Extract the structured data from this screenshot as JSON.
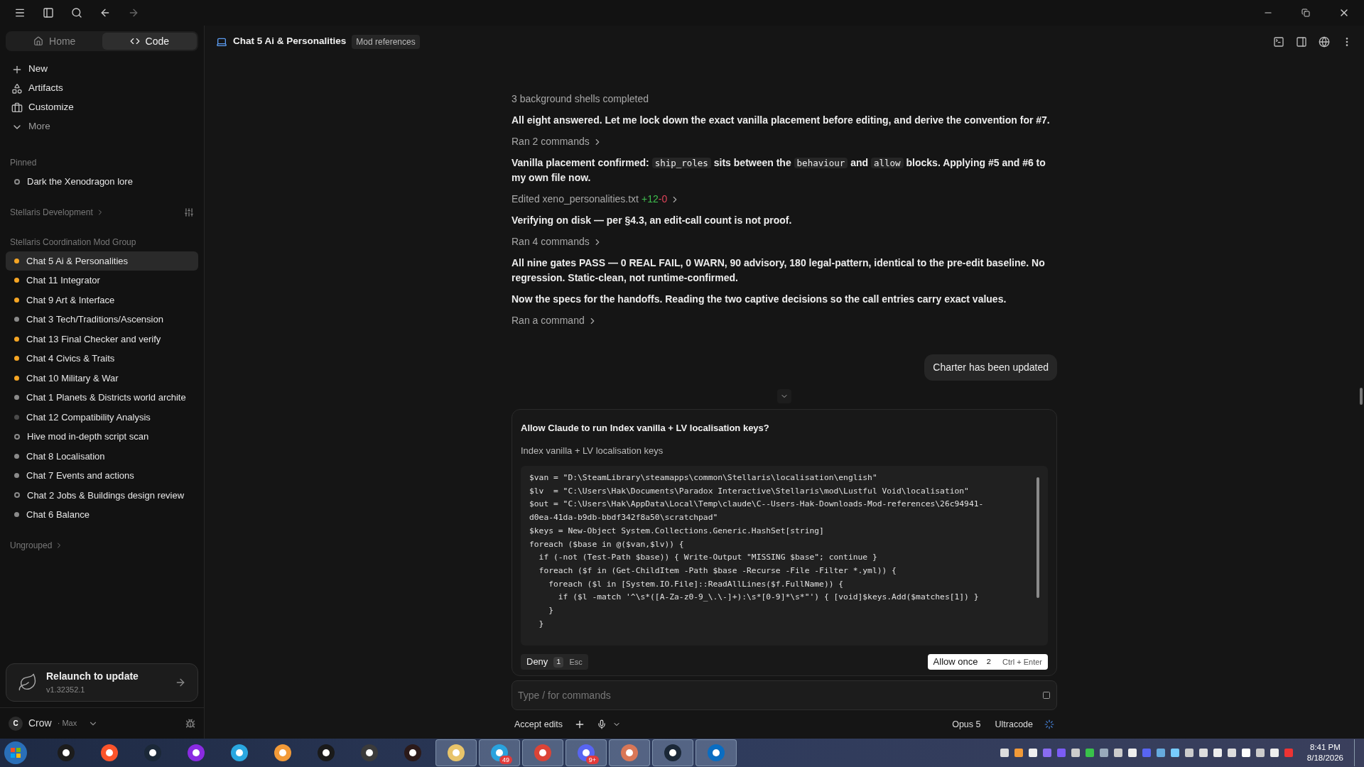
{
  "sidebar": {
    "tabs": [
      {
        "label": "Home",
        "selected": false
      },
      {
        "label": "Code",
        "selected": true
      }
    ],
    "nav": [
      {
        "label": "New",
        "kind": "new"
      },
      {
        "label": "Artifacts",
        "kind": "artifacts"
      },
      {
        "label": "Customize",
        "kind": "customize"
      },
      {
        "label": "More",
        "kind": "more"
      }
    ],
    "pinned": {
      "title": "Pinned",
      "items": [
        {
          "label": "Dark the Xenodragon lore",
          "color": "#8a8a8a",
          "kind": "hollow",
          "selected": false
        }
      ]
    },
    "groups": [
      {
        "title": "Stellaris Development"
      },
      {
        "title": "Stellaris Coordination Mod Group",
        "items": [
          {
            "label": "Chat 5 Ai & Personalities",
            "color": "#f5a524",
            "kind": "filled",
            "selected": true
          },
          {
            "label": "Chat 11 Integrator",
            "color": "#f5a524",
            "kind": "filled",
            "selected": false
          },
          {
            "label": "Chat 9 Art & Interface",
            "color": "#f5a524",
            "kind": "filled",
            "selected": false
          },
          {
            "label": "Chat 3 Tech/Traditions/Ascension",
            "color": "#8a8a8a",
            "kind": "filled",
            "selected": false
          },
          {
            "label": "Chat 13 Final Checker and verify",
            "color": "#f5a524",
            "kind": "filled",
            "selected": false
          },
          {
            "label": "Chat 4 Civics & Traits",
            "color": "#f5a524",
            "kind": "filled",
            "selected": false
          },
          {
            "label": "Chat 10 Military & War",
            "color": "#f5a524",
            "kind": "filled",
            "selected": false
          },
          {
            "label": "Chat 1 Planets & Districts world archite",
            "color": "#8a8a8a",
            "kind": "filled",
            "selected": false
          },
          {
            "label": "Chat 12 Compatibility Analysis",
            "color": "#4a4a4a",
            "kind": "filled",
            "selected": false
          },
          {
            "label": "Hive mod in-depth script scan",
            "color": "#8a8a8a",
            "kind": "hollow",
            "selected": false
          },
          {
            "label": "Chat 8 Localisation",
            "color": "#8a8a8a",
            "kind": "filled",
            "selected": false
          },
          {
            "label": "Chat 7 Events and actions",
            "color": "#8a8a8a",
            "kind": "filled",
            "selected": false
          },
          {
            "label": "Chat 2 Jobs & Buildings design review",
            "color": "#8a8a8a",
            "kind": "hollow",
            "selected": false
          },
          {
            "label": "Chat 6 Balance",
            "color": "#8a8a8a",
            "kind": "filled",
            "selected": false
          }
        ]
      },
      {
        "title": "Ungrouped"
      }
    ],
    "update": {
      "title": "Relaunch to update",
      "version": "v1.32352.1"
    },
    "user": {
      "initial": "C",
      "name": "Crow",
      "plan": "· Max"
    }
  },
  "header": {
    "title": "Chat 5 Ai & Personalities",
    "tag": "Mod references"
  },
  "messages": [
    {
      "kind": "status",
      "text": "3 background shells completed"
    },
    {
      "kind": "text",
      "parts": [
        {
          "kind": "text",
          "text": "All eight answered. Let me lock down the exact vanilla placement before editing, and derive the convention for #7."
        }
      ]
    },
    {
      "kind": "action",
      "text": "Ran 2 commands"
    },
    {
      "kind": "text",
      "parts": [
        {
          "kind": "text",
          "text": "Vanilla placement confirmed: "
        },
        {
          "kind": "code",
          "text": "ship_roles"
        },
        {
          "kind": "text",
          "text": " sits between the "
        },
        {
          "kind": "code",
          "text": "behaviour"
        },
        {
          "kind": "text",
          "text": " and "
        },
        {
          "kind": "code",
          "text": "allow"
        },
        {
          "kind": "text",
          "text": " blocks. Applying #5 and #6 to my own file now."
        }
      ]
    },
    {
      "kind": "edit",
      "text": "Edited xeno_personalities.txt",
      "added": "+12",
      "removed": "-0"
    },
    {
      "kind": "text",
      "parts": [
        {
          "kind": "text",
          "text": "Verifying on disk — per §4.3, an edit-call count is not proof."
        }
      ]
    },
    {
      "kind": "action",
      "text": "Ran 4 commands"
    },
    {
      "kind": "text",
      "parts": [
        {
          "kind": "text",
          "text": "All nine gates PASS — **0 REAL FAIL, 0 WARN, 90 advisory, 180 legal-pattern**, identical to the pre-edit baseline. No regression. Static-clean, not runtime-confirmed."
        }
      ]
    },
    {
      "kind": "text",
      "parts": [
        {
          "kind": "text",
          "text": "Now the specs for the handoffs. Reading the two captive decisions so the call entries carry exact values."
        }
      ]
    },
    {
      "kind": "action",
      "text": "Ran a command"
    },
    {
      "kind": "user",
      "text": "Charter has been updated"
    }
  ],
  "permission": {
    "title": "Allow Claude to run Index vanilla + LV localisation keys?",
    "subtitle": "Index vanilla + LV localisation keys",
    "code": [
      "$van = \"D:\\SteamLibrary\\steamapps\\common\\Stellaris\\localisation\\english\"",
      "$lv  = \"C:\\Users\\Hak\\Documents\\Paradox Interactive\\Stellaris\\mod\\Lustful Void\\localisation\"",
      "$out = \"C:\\Users\\Hak\\AppData\\Local\\Temp\\claude\\C--Users-Hak-Downloads-Mod-references\\26c94941-",
      "d0ea-41da-b9db-bbdf342f8a50\\scratchpad\"",
      "$keys = New-Object System.Collections.Generic.HashSet[string]",
      "foreach ($base in @($van,$lv)) {",
      "  if (-not (Test-Path $base)) { Write-Output \"MISSING $base\"; continue }",
      "  foreach ($f in (Get-ChildItem -Path $base -Recurse -File -Filter *.yml)) {",
      "    foreach ($l in [System.IO.File]::ReadAllLines($f.FullName)) {",
      "      if ($l -match '^\\s*([A-Za-z0-9_\\.\\-]+):\\s*[0-9]*\\s*\"') { [void]$keys.Add($matches[1]) }",
      "    }",
      "  }"
    ],
    "deny": {
      "label": "Deny",
      "key": "1",
      "shortcut": "Esc"
    },
    "allow": {
      "label": "Allow once",
      "key": "2",
      "shortcut": "Ctrl + Enter"
    }
  },
  "composer": {
    "placeholder": "Type / for commands",
    "mode": "Accept edits",
    "model": "Opus 5",
    "effort": "Ultracode"
  },
  "taskbar": {
    "apps": [
      {
        "color": "#1c1c1c",
        "running": false
      },
      {
        "color": "#fb542b",
        "running": false
      },
      {
        "color": "#1b2838",
        "running": false
      },
      {
        "color": "#8a2be2",
        "running": false
      },
      {
        "color": "#2aa7e0",
        "running": false
      },
      {
        "color": "#f29a38",
        "running": false
      },
      {
        "color": "#1a1a1a",
        "running": false
      },
      {
        "color": "#3b3b3b",
        "running": false
      },
      {
        "color": "#2b1a1a",
        "running": false
      },
      {
        "color": "#e8c46a",
        "running": true
      },
      {
        "color": "#2aa3de",
        "running": true,
        "badge": "49"
      },
      {
        "color": "#db4437",
        "running": true
      },
      {
        "color": "#5865f2",
        "running": true,
        "badge": "9+"
      },
      {
        "color": "#d97757",
        "running": true
      },
      {
        "color": "#1b2838",
        "running": true
      },
      {
        "color": "#0a6dc2",
        "running": true
      }
    ],
    "time": "8:41 PM",
    "date": "8/18/2026"
  }
}
